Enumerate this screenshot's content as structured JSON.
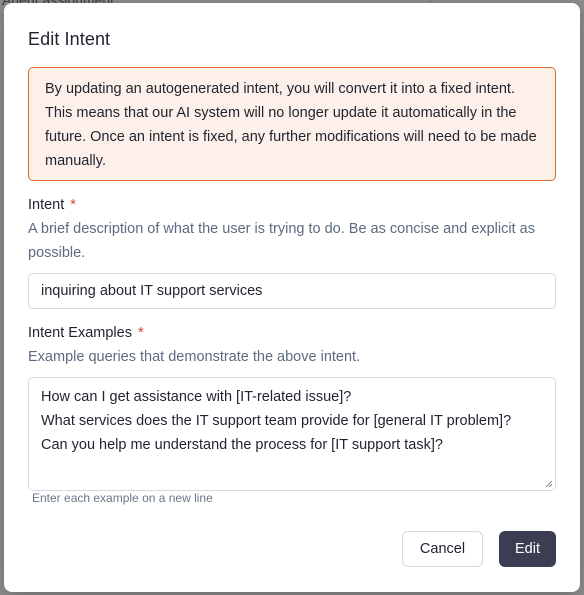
{
  "background": {
    "partial_text": "Agent assignment"
  },
  "modal": {
    "title": "Edit Intent",
    "warning": "By updating an autogenerated intent, you will convert it into a fixed intent. This means that our AI system will no longer update it automatically in the future. Once an intent is fixed, any further modifications will need to be made manually.",
    "intent": {
      "label": "Intent",
      "required_mark": "*",
      "help": "A brief description of what the user is trying to do. Be as concise and explicit as possible.",
      "value": "inquiring about IT support services"
    },
    "examples": {
      "label": "Intent Examples",
      "required_mark": "*",
      "help": "Example queries that demonstrate the above intent.",
      "lines": [
        "How can I get assistance with [IT-related issue]?",
        "What services does the IT support team provide for [general IT problem]?",
        "Can you help me understand the process for [IT support task]?"
      ],
      "hint": "Enter each example on a new line"
    },
    "buttons": {
      "cancel": "Cancel",
      "edit": "Edit"
    }
  },
  "colors": {
    "warning_border": "#d9712f",
    "warning_bg": "#fdf0ea",
    "required": "#d6423f",
    "primary_button": "#3b3d52"
  }
}
